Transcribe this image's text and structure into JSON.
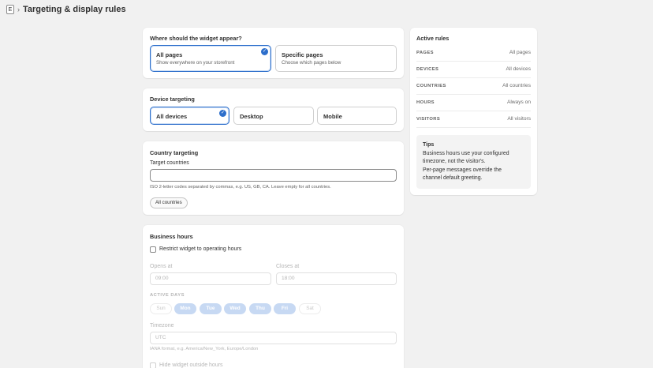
{
  "header": {
    "app_icon": "E",
    "separator": "›",
    "title": "Targeting & display rules"
  },
  "pages_card": {
    "title": "Where should the widget appear?",
    "options": [
      {
        "label": "All pages",
        "description": "Show everywhere on your storefront",
        "selected": true
      },
      {
        "label": "Specific pages",
        "description": "Choose which pages below",
        "selected": false
      }
    ]
  },
  "device_card": {
    "title": "Device targeting",
    "options": [
      {
        "label": "All devices",
        "selected": true
      },
      {
        "label": "Desktop",
        "selected": false
      },
      {
        "label": "Mobile",
        "selected": false
      }
    ]
  },
  "country_card": {
    "title": "Country targeting",
    "field_label": "Target countries",
    "value": "",
    "help": "ISO 2-letter codes separated by commas, e.g. US, GB, CA. Leave empty for all countries.",
    "chip": "All countries"
  },
  "hours_card": {
    "title": "Business hours",
    "restrict_label": "Restrict widget to operating hours",
    "restrict_checked": false,
    "opens_label": "Opens at",
    "opens_value": "09:00",
    "closes_label": "Closes at",
    "closes_value": "18:00",
    "active_days_label": "ACTIVE DAYS",
    "days": [
      {
        "label": "Sun",
        "active": false
      },
      {
        "label": "Mon",
        "active": true
      },
      {
        "label": "Tue",
        "active": true
      },
      {
        "label": "Wed",
        "active": true
      },
      {
        "label": "Thu",
        "active": true
      },
      {
        "label": "Fri",
        "active": true
      },
      {
        "label": "Sat",
        "active": false
      }
    ],
    "timezone_label": "Timezone",
    "timezone_value": "UTC",
    "timezone_help": "IANA format, e.g. America/New_York, Europe/London",
    "hide_label": "Hide widget outside hours"
  },
  "summary": {
    "title": "Active rules",
    "rows": [
      {
        "key": "PAGES",
        "value": "All pages"
      },
      {
        "key": "DEVICES",
        "value": "All devices"
      },
      {
        "key": "COUNTRIES",
        "value": "All countries"
      },
      {
        "key": "HOURS",
        "value": "Always on"
      },
      {
        "key": "VISITORS",
        "value": "All visitors"
      }
    ],
    "tips_title": "Tips",
    "tips_lines": [
      "Business hours use your configured",
      "timezone, not the visitor's.",
      "Per-page messages override the",
      "channel default greeting."
    ]
  },
  "colors": {
    "accent": "#2c6ecb",
    "background": "#f1f1f1",
    "day_active": "#c7d9f3"
  },
  "icons": {
    "selected": "check-circle-icon"
  }
}
